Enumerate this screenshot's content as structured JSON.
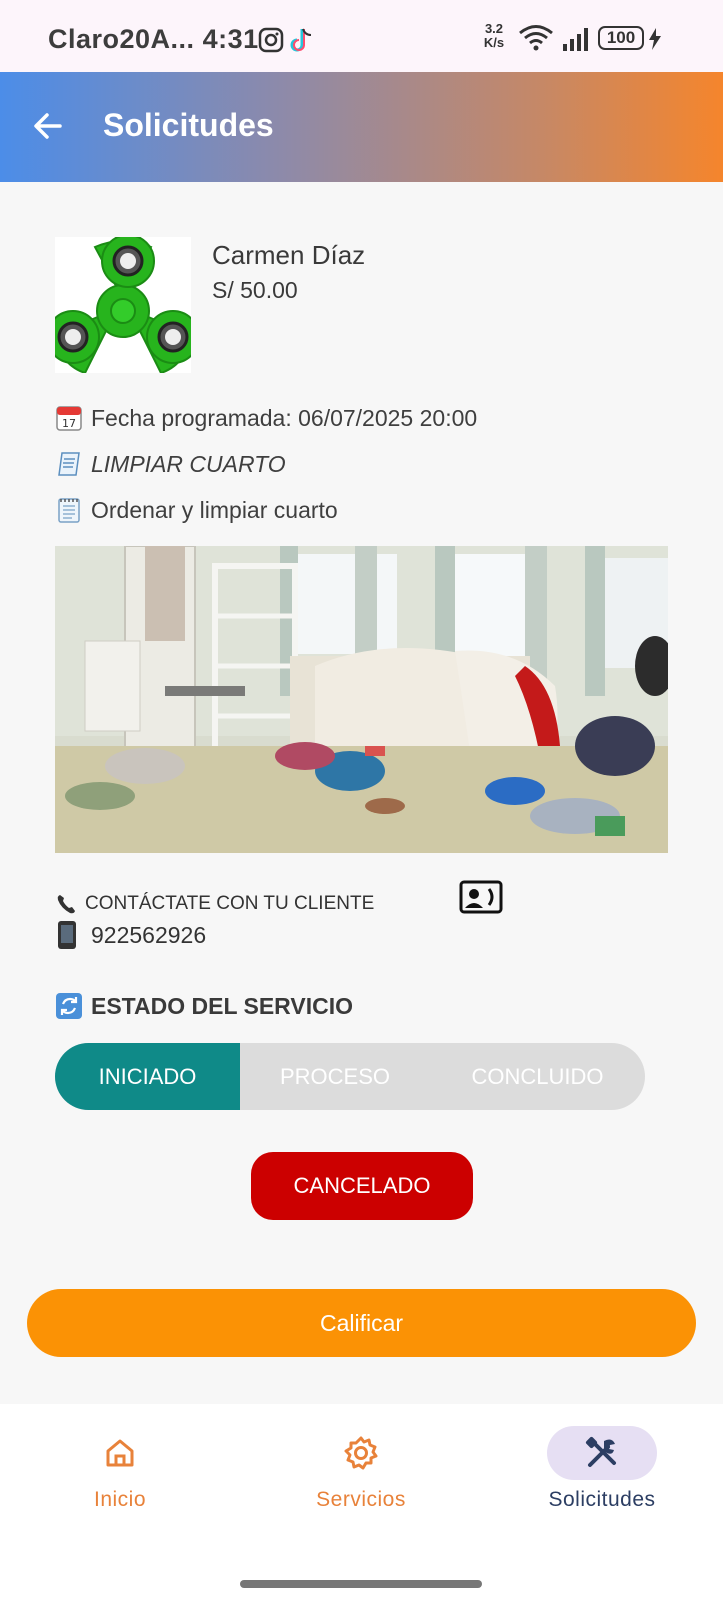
{
  "status_bar": {
    "carrier": "Claro20A...",
    "time": "4:31",
    "net_speed_value": "3.2",
    "net_speed_unit": "K/s",
    "battery": "100"
  },
  "app_bar": {
    "title": "Solicitudes"
  },
  "request": {
    "client_name": "Carmen Díaz",
    "price": "S/ 50.00",
    "scheduled": "Fecha programada: 06/07/2025 20:00",
    "service_title": "LIMPIAR CUARTO",
    "description": "Ordenar y limpiar cuarto"
  },
  "contact": {
    "label": "CONTÁCTATE CON TU CLIENTE",
    "phone": "922562926"
  },
  "status_section": {
    "title": "ESTADO DEL SERVICIO",
    "steps": [
      "INICIADO",
      "PROCESO",
      "CONCLUIDO"
    ],
    "active_step": "INICIADO",
    "cancel_label": "CANCELADO"
  },
  "rate_button": "Calificar",
  "bottom_nav": {
    "items": [
      {
        "label": "Inicio",
        "icon": "home-icon"
      },
      {
        "label": "Servicios",
        "icon": "gear-icon"
      },
      {
        "label": "Solicitudes",
        "icon": "tools-icon"
      }
    ],
    "active": "Solicitudes"
  },
  "colors": {
    "accent_orange": "#fb9205",
    "active_step": "#0f8a88",
    "cancel_red": "#cc0000",
    "nav_active_text": "#2c3e63",
    "nav_inactive": "#e8823a",
    "nav_pill": "#e6dff3"
  }
}
